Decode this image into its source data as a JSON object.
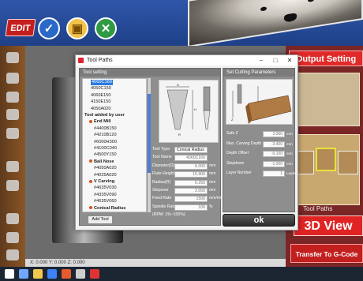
{
  "app": {
    "logo_text": "EDIT",
    "output_setting": "Output Setting",
    "tool_paths_tab": "Tool Paths",
    "view_3d": "3D View",
    "transfer": "Transfer To G-Code",
    "statusbar": "X: 0.000  Y: 0.000  Z: 0.000"
  },
  "dialog": {
    "title": "Tool Paths",
    "tool_setting_header": "Tool setting",
    "cutting_header": "Set Cutting Parameters",
    "add_tool": "Add Tool",
    "ok": "ok",
    "tree": [
      {
        "label": "4060C160",
        "selected": true
      },
      {
        "label": "4050C150"
      },
      {
        "label": "4060E150"
      },
      {
        "label": "4150E150"
      },
      {
        "label": "4050A020"
      },
      {
        "label": "Tool added by user",
        "group": true
      },
      {
        "label": "End Mill",
        "group": true
      },
      {
        "label": "#4400B150"
      },
      {
        "label": "#4210B120"
      },
      {
        "label": "#6000H300"
      },
      {
        "label": "#4100C040"
      },
      {
        "label": "#4500Y150"
      },
      {
        "label": "Ball Nose",
        "group": true
      },
      {
        "label": "#4050A020"
      },
      {
        "label": "#4025A020"
      },
      {
        "label": "V Carving",
        "group": true
      },
      {
        "label": "#4635V030"
      },
      {
        "label": "#4335V090"
      },
      {
        "label": "#4635V060"
      },
      {
        "label": "Conical Radius",
        "group": true
      }
    ],
    "fields": [
      {
        "label": "Tool Type",
        "value": "Conical Radius",
        "unit": ""
      },
      {
        "label": "Tool Name",
        "value": "4060C160",
        "unit": ""
      },
      {
        "label": "Diameter(D)",
        "value": "6.000",
        "unit": "mm"
      },
      {
        "label": "Flute Height(H)",
        "value": "15.900",
        "unit": "mm"
      },
      {
        "label": "Radius(R)",
        "value": "0.250",
        "unit": "mm"
      },
      {
        "label": "Stepover",
        "value": "2.000",
        "unit": "mm"
      },
      {
        "label": "Feed Rate",
        "value": "1500",
        "unit": "mm/min"
      },
      {
        "label": "Spindle Rate",
        "value": "100",
        "unit": "%"
      }
    ],
    "rpm_note": "(RPM: 1%~100%)",
    "cutting_fields": [
      {
        "label": "Safe Z",
        "value": "3.000",
        "unit": "mm"
      },
      {
        "label": "Max. Carving Depth",
        "value": "-3.400",
        "unit": "mm"
      },
      {
        "label": "Depth Offset",
        "value": "-0.100",
        "unit": "mm"
      },
      {
        "label": "Stepdown",
        "value": "-1.000",
        "unit": "mm"
      },
      {
        "label": "Layer Number",
        "value": "1",
        "unit": "Layer"
      }
    ]
  },
  "colors": {
    "accent_red": "#e02a2a",
    "selection_blue": "#2b7bdc",
    "panel_gray": "#8e8e8e"
  }
}
